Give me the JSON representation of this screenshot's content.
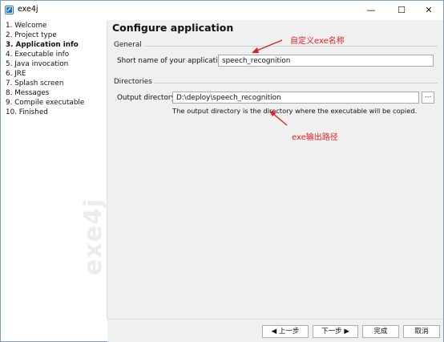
{
  "window": {
    "title": "exe4j",
    "icon": "exe4j-app-icon",
    "minimize_glyph": "—",
    "maximize_glyph": "☐",
    "close_glyph": "✕"
  },
  "sidebar": {
    "watermark": "exe4j",
    "steps": [
      {
        "label": "1. Welcome",
        "active": false
      },
      {
        "label": "2. Project type",
        "active": false
      },
      {
        "label": "3. Application info",
        "active": true
      },
      {
        "label": "4. Executable info",
        "active": false
      },
      {
        "label": "5. Java invocation",
        "active": false
      },
      {
        "label": "6. JRE",
        "active": false
      },
      {
        "label": "7. Splash screen",
        "active": false
      },
      {
        "label": "8. Messages",
        "active": false
      },
      {
        "label": "9. Compile executable",
        "active": false
      },
      {
        "label": "10. Finished",
        "active": false
      }
    ]
  },
  "main": {
    "page_title": "Configure application",
    "general": {
      "title": "General",
      "short_name_label": "Short name of your application:",
      "short_name_value": "speech_recognition"
    },
    "directories": {
      "title": "Directories",
      "output_label": "Output directory:",
      "output_value": "D:\\deploy\\speech_recognition",
      "browse_label": "...",
      "note": "The output directory is the directory where the executable will be copied."
    }
  },
  "annotations": {
    "name_note": "自定义exe名称",
    "path_note": "exe输出路径",
    "color": "#e02020"
  },
  "footer": {
    "back_label": "◀ 上一步",
    "next_label": "下一步 ▶",
    "finish_label": "完成",
    "cancel_label": "取消"
  }
}
